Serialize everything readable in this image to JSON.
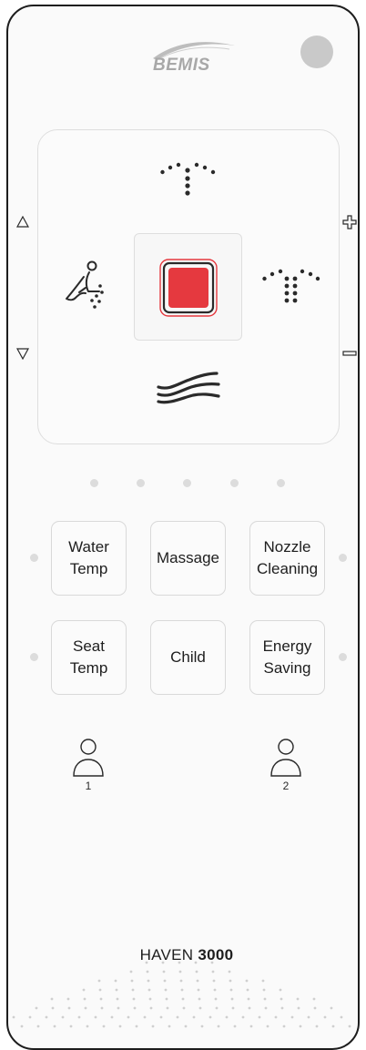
{
  "brand": {
    "logo_text": "BEMIS",
    "model_prefix": "HAVEN",
    "model_number": "3000"
  },
  "colors": {
    "stop_red": "#e5393f",
    "stop_border": "#e5393f",
    "outline": "#1d1d1d",
    "led_off": "#dcdcdc",
    "power_indicator": "#c9c9c9"
  },
  "icons": {
    "power": "power-indicator",
    "top": "front-wash-spray-icon",
    "left": "seated-person-icon",
    "right": "rear-wash-spray-icon",
    "bottom": "air-dryer-icon",
    "center": "stop-icon",
    "up": "triangle-up-icon",
    "down": "triangle-down-icon",
    "plus": "plus-icon",
    "minus": "minus-icon",
    "user": "user-icon"
  },
  "function_buttons": [
    {
      "line1": "Water",
      "line2": "Temp"
    },
    {
      "line1": "Massage",
      "line2": ""
    },
    {
      "line1": "Nozzle",
      "line2": "Cleaning"
    },
    {
      "line1": "Seat",
      "line2": "Temp"
    },
    {
      "line1": "Child",
      "line2": ""
    },
    {
      "line1": "Energy",
      "line2": "Saving"
    }
  ],
  "level_indicators_count": 5,
  "users": [
    {
      "number": "1"
    },
    {
      "number": "2"
    }
  ]
}
